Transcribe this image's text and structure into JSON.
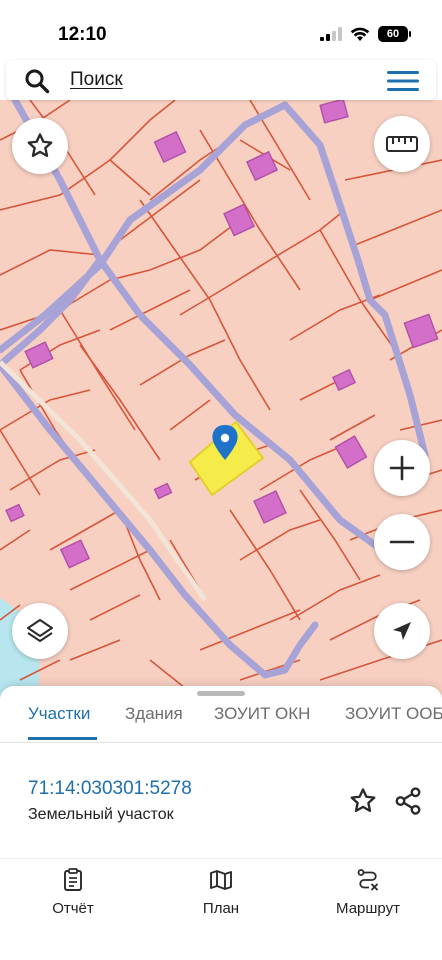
{
  "status_bar": {
    "time": "12:10",
    "battery": "60",
    "icons": [
      "signal-icon",
      "wifi-icon",
      "battery-icon"
    ]
  },
  "search": {
    "label": "Поиск",
    "icons": [
      "search-icon",
      "menu-icon"
    ]
  },
  "map": {
    "selected_parcel_color": "#f5ec4a",
    "parcel_fill_color": "#f7d0c2",
    "parcel_border_color": "#d7563a",
    "building_color": "#d46fc9",
    "road_color": "#a7a3d6",
    "water_color": "#b7e6ee",
    "pin_color": "#1e73c8",
    "controls": [
      "favorite-star-icon",
      "ruler-icon",
      "zoom-in-icon",
      "zoom-out-icon",
      "layers-icon",
      "locate-arrow-icon"
    ]
  },
  "sheet": {
    "tabs": [
      {
        "label": "Участки",
        "active": true
      },
      {
        "label": "Здания",
        "active": false
      },
      {
        "label": "ЗОУИТ ОКН",
        "active": false
      },
      {
        "label": "ЗОУИТ ООБ",
        "active": false
      }
    ],
    "parcel": {
      "number": "71:14:030301:5278",
      "type": "Земельный участок"
    },
    "accent_color": "#1e6fae"
  },
  "bottom_nav": {
    "items": [
      {
        "label": "Отчёт",
        "icon": "report-icon"
      },
      {
        "label": "План",
        "icon": "map-plan-icon"
      },
      {
        "label": "Маршрут",
        "icon": "route-icon"
      }
    ]
  }
}
